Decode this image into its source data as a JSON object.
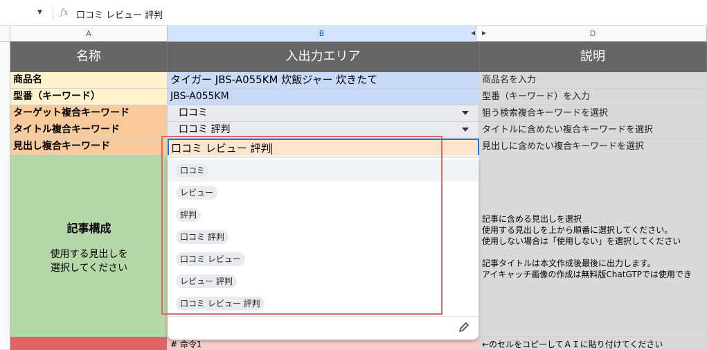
{
  "formula_bar": {
    "content": "口コミ レビュー 評判",
    "fx_label": "fx"
  },
  "columns": {
    "a": "A",
    "b": "B",
    "d": "D"
  },
  "header_row": {
    "name": "名称",
    "io_area": "入出力エリア",
    "description": "説明"
  },
  "rows": [
    {
      "label": "商品名",
      "value": "タイガー JBS-A055KM 炊飯ジャー 炊きたて",
      "description": "商品名を入力"
    },
    {
      "label": "型番（キーワード）",
      "value": "JBS-A055KM",
      "description": "型番（キーワード）を入力"
    },
    {
      "label": "ターゲット複合キーワード",
      "value": "口コミ",
      "description": "狙う検索複合キーワードを選択"
    },
    {
      "label": "タイトル複合キーワード",
      "value": "口コミ 評判",
      "description": "タイトルに含めたい複合キーワードを選択"
    },
    {
      "label": "見出し複合キーワード",
      "value": "口コミ レビュー 評判",
      "description": "見出しに含めたい複合キーワードを選択"
    }
  ],
  "section": {
    "title": "記事構成",
    "hint_line1": "使用する見出しを",
    "hint_line2": "選択してください",
    "description_lines": [
      "記事に含める見出しを選択",
      "使用する見出しを上から順番に選択してください。",
      "使用しない場合は「使用しない」を選択してください",
      "",
      "記事タイトルは本文作成後最後に出力します。",
      "アイキャッチ画像の作成は無料版ChatGTPでは使用でき"
    ]
  },
  "dropdown_options": [
    "口コミ",
    "レビュー",
    "評判",
    "口コミ 評判",
    "口コミ レビュー",
    "レビュー 評判",
    "口コミ レビュー 評判"
  ],
  "bottom_row": {
    "value": "# 命令1",
    "description": "←のセルをコピーしてＡＩに貼り付けてください"
  },
  "colors": {
    "header_bg": "#666666",
    "label_yellow": "#fff2cc",
    "label_orange": "#f9cb9c",
    "input_blue": "#c9daf8",
    "section_green": "#b6d7a8",
    "bottom_red": "#e06666",
    "highlight_box": "#e06666"
  }
}
